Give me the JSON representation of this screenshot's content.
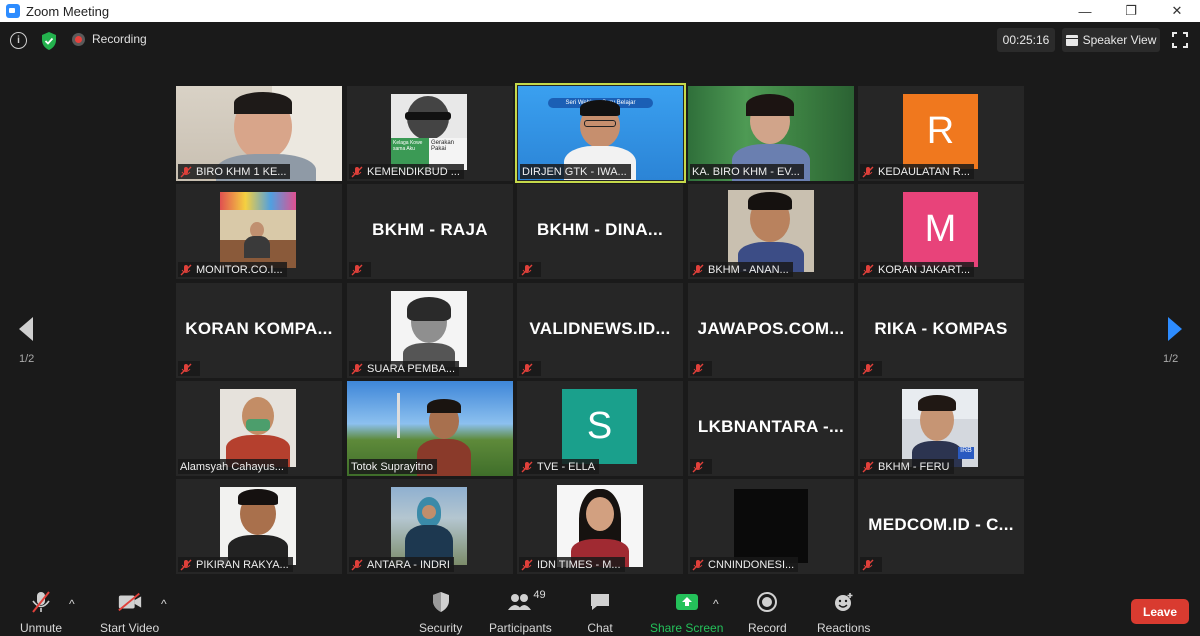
{
  "window": {
    "title": "Zoom Meeting",
    "minimize": "—",
    "maximize": "❐",
    "close": "✕"
  },
  "topbar": {
    "recording_label": "Recording",
    "timer": "00:25:16",
    "view_label": "Speaker View"
  },
  "pager": {
    "left_label": "1/2",
    "right_label": "1/2"
  },
  "participants": [
    {
      "name": "BIRO KHM 1 KE...",
      "type": "video",
      "muted": true
    },
    {
      "name": "KEMENDIKBUD ...",
      "type": "video",
      "muted": true
    },
    {
      "name": "DIRJEN GTK - IWA...",
      "type": "video",
      "muted": false,
      "active": true
    },
    {
      "name": "KA. BIRO KHM - EV...",
      "type": "video",
      "muted": false
    },
    {
      "name": "KEDAULATAN R...",
      "type": "avatar",
      "letter": "R",
      "color": "#f0781e",
      "muted": true
    },
    {
      "name": "MONITOR.CO.I...",
      "type": "video",
      "muted": true
    },
    {
      "name": "BKHM - RAJA",
      "type": "text",
      "muted": true
    },
    {
      "name": "BKHM - DINA...",
      "type": "text",
      "muted": true
    },
    {
      "name": "BKHM - ANAN...",
      "type": "video",
      "muted": true
    },
    {
      "name": "KORAN JAKART...",
      "type": "avatar",
      "letter": "M",
      "color": "#e8437a",
      "muted": true
    },
    {
      "name": "KORAN KOMPA...",
      "type": "text",
      "muted": true
    },
    {
      "name": "SUARA PEMBA...",
      "type": "video",
      "muted": true
    },
    {
      "name": "VALIDNEWS.ID...",
      "type": "text",
      "muted": true
    },
    {
      "name": "JAWAPOS.COM...",
      "type": "text",
      "muted": true
    },
    {
      "name": "RIKA - KOMPAS",
      "type": "text",
      "muted": true
    },
    {
      "name": "Alamsyah Cahayus...",
      "type": "video",
      "muted": false
    },
    {
      "name": "Totok Suprayitno",
      "type": "video",
      "muted": false
    },
    {
      "name": "TVE - ELLA",
      "type": "avatar",
      "letter": "S",
      "color": "#1aa08c",
      "muted": true
    },
    {
      "name": "LKBNANTARA -...",
      "type": "text",
      "muted": true
    },
    {
      "name": "BKHM - FERU",
      "type": "video",
      "muted": true
    },
    {
      "name": "PIKIRAN RAKYA...",
      "type": "video",
      "muted": true
    },
    {
      "name": "ANTARA - INDRI",
      "type": "video",
      "muted": true
    },
    {
      "name": "IDN TIMES - M...",
      "type": "video",
      "muted": true
    },
    {
      "name": "CNNINDONESI...",
      "type": "video",
      "muted": true
    },
    {
      "name": "MEDCOM.ID - C...",
      "type": "text",
      "muted": true
    }
  ],
  "slide_text": {
    "line1": "Seri Webinar Guru Belajar"
  },
  "sign_text": {
    "left": "Kelaga Kowe sama Aku",
    "right": "Gerakan Pakai"
  },
  "toolbar": {
    "unmute": "Unmute",
    "start_video": "Start Video",
    "security": "Security",
    "participants": "Participants",
    "participants_count": "49",
    "chat": "Chat",
    "share_screen": "Share Screen",
    "record": "Record",
    "reactions": "Reactions",
    "leave": "Leave"
  },
  "colors": {
    "background": "#1a1a1a",
    "tile": "#262626",
    "active_outline": "#c5d94a",
    "share_green": "#24c15a",
    "leave_red": "#d93b30",
    "zoom_blue": "#2d8cff"
  }
}
